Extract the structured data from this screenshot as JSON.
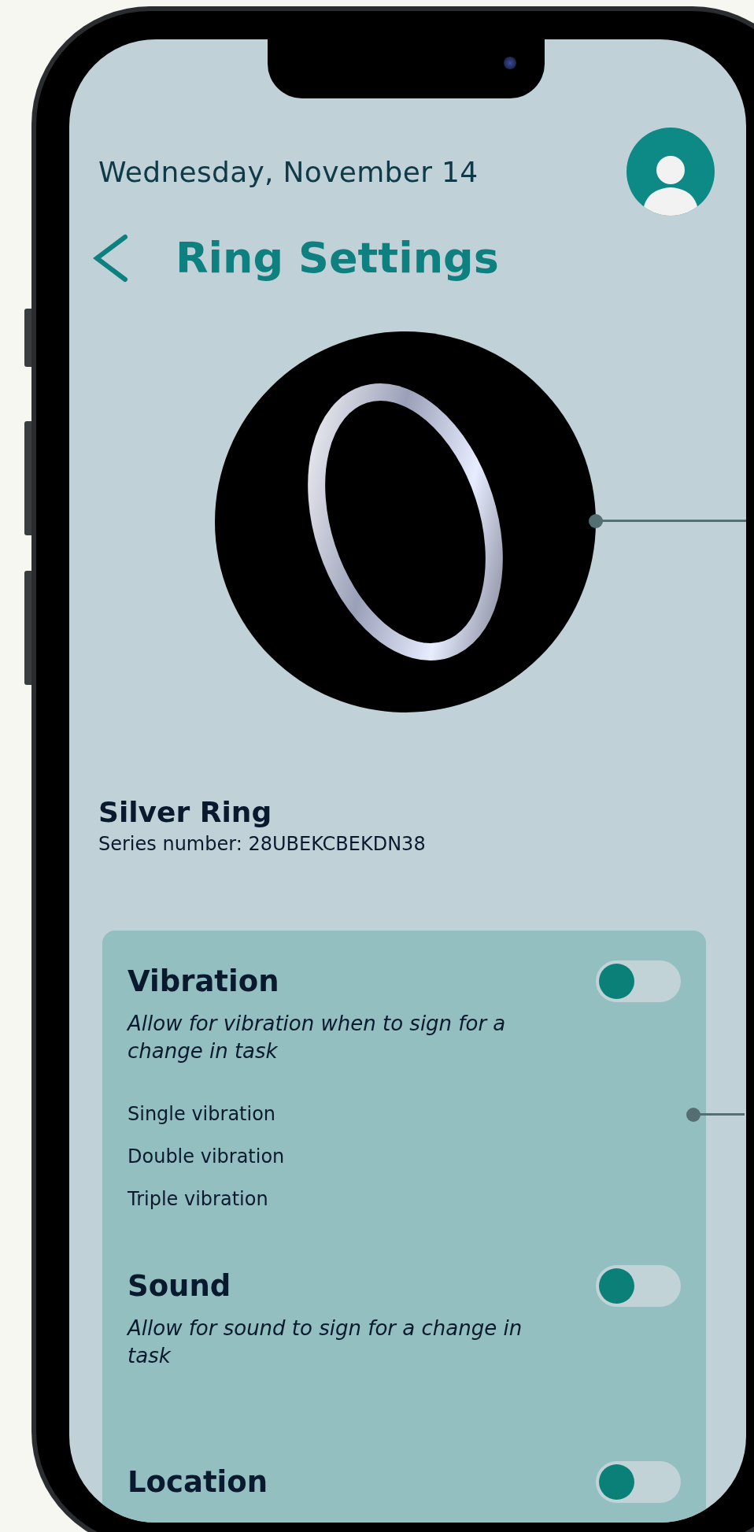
{
  "header": {
    "date": "Wednesday, November 14",
    "title": "Ring Settings"
  },
  "device": {
    "name": "Silver Ring",
    "serial": "Series number: 28UBEKCBEKDN38"
  },
  "settings": [
    {
      "title": "Vibration",
      "description": "Allow for vibration when to sign for a change in task",
      "on": false,
      "options": [
        "Single vibration",
        "Double vibration",
        "Triple vibration"
      ]
    },
    {
      "title": "Sound",
      "description": "Allow for sound to sign for a change in task",
      "on": false
    },
    {
      "title": "Location",
      "on": false
    }
  ]
}
